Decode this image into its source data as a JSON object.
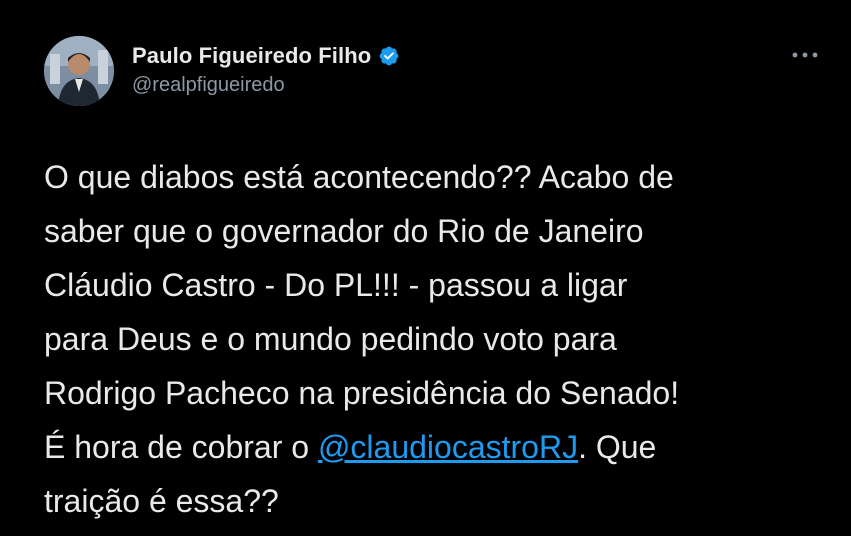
{
  "author": {
    "display_name": "Paulo Figueiredo Filho",
    "handle": "@realpfigueiredo",
    "verified": true,
    "avatar_icon": "user-photo-avatar"
  },
  "header": {
    "more_icon": "more-horizontal-icon"
  },
  "tweet": {
    "line1": "O que diabos está acontecendo?? Acabo de",
    "line2": "saber que o governador do Rio de Janeiro",
    "line3": "Cláudio Castro - Do PL!!! - passou a ligar",
    "line4": "para Deus e o mundo pedindo voto para",
    "line5": "Rodrigo Pacheco na presidência do Senado!",
    "line6_before": "É hora de cobrar o ",
    "mention": "@claudiocastroRJ",
    "line6_after": ". Que",
    "line7": "traição é essa??"
  },
  "colors": {
    "background": "#000000",
    "text": "#e7e9ea",
    "secondary": "#8b98a5",
    "link": "#1d9bf0",
    "verified_badge": "#1d9bf0"
  }
}
